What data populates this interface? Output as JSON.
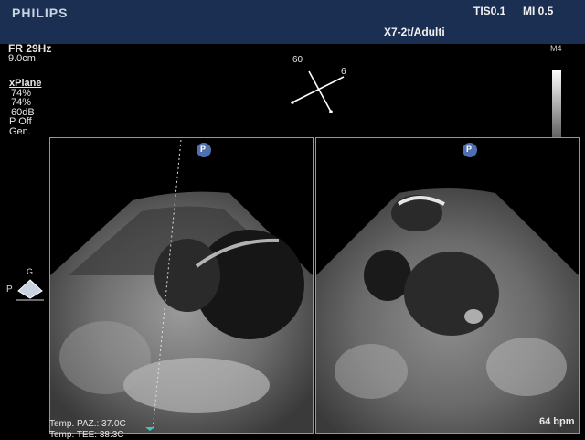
{
  "header": {
    "brand": "PHILIPS",
    "tis": "TIS0.1",
    "mi": "MI 0.5",
    "probe": "X7-2t/Adulti"
  },
  "params": {
    "frame_rate": "FR 29Hz",
    "depth": "9.0cm"
  },
  "xplane": {
    "title": "xPlane",
    "values": [
      "74%",
      "74%",
      "60dB",
      "P Off",
      "Gen."
    ]
  },
  "map": {
    "label": "M4"
  },
  "orientation": {
    "angle1": "60",
    "angle2": "6"
  },
  "marker": {
    "g_label": "G",
    "p_label": "P"
  },
  "image_markers": {
    "p_marker": "P"
  },
  "footer": {
    "temp_paz": "Temp. PAZ.: 37.0C",
    "temp_tee": "Temp. TEE: 38.3C",
    "heart_rate": "64 bpm"
  },
  "colors": {
    "header_bg": "#1b2f52",
    "frame_border": "#b09070",
    "marker_blue": "#4f6fb0",
    "cursor_teal": "#3bc7c0"
  }
}
